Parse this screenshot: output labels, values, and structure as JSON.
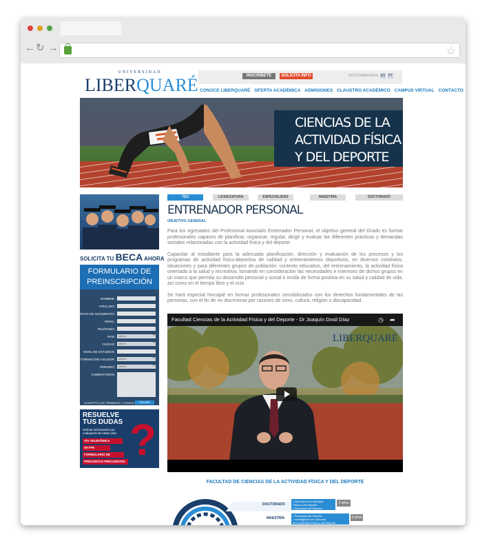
{
  "browser": {
    "colors": {
      "close": "#e0443e",
      "min": "#dea123",
      "max": "#53a548",
      "secure": "#58a23c"
    }
  },
  "site": {
    "logo_top": "UNIVERSIDAD",
    "logo_name_a": "LIBER",
    "logo_name_b": "QUARÉ",
    "top_buttons": {
      "inscribete": "INSCRÍBETE",
      "solicita": "SOLICITA INFO"
    },
    "utils": {
      "noticias": "NOTICIAS",
      "idiomas": "IDIOMAS",
      "es": "ES",
      "pt": "PT"
    },
    "menu": [
      "CONOCE LIBERQUARÉ",
      "OFERTA ACADÉMICA",
      "ADMISIONES",
      "CLAUSTRO ACADÉMICO",
      "CAMPUS VIRTUAL",
      "CONTACTO"
    ],
    "hero_title": [
      "CIENCIAS DE LA",
      "ACTIVIDAD FÍSICA",
      "Y DEL DEPORTE"
    ]
  },
  "sidebar": {
    "beca_pre": "SOLICITA TU",
    "beca": "BECA",
    "beca_post": "AHORA",
    "form_title": [
      "FORMULARIO DE",
      "PREINSCRIPCIÓN"
    ],
    "fields": [
      "NOMBRE:",
      "APELLIDO:",
      "FECHA DE NACIMIENTO:",
      "EMAIL:",
      "TELÉFONO:",
      "PAÍS:",
      "CIUDAD:",
      "NIVEL DE ESTUDIOS:",
      "FORMACIÓN A ELEGIR:",
      "PERIODO:",
      "COMENTARIOS:"
    ],
    "select_placeholder": "selecc.",
    "terms": "ACEPTO LOS TÉRMINOS Y CONDICIONES",
    "submit": "ENVIAR",
    "dudas_title": [
      "RESUELVE",
      "TUS DUDAS"
    ],
    "dudas_sub": [
      "Solicita información por",
      "cualquiera de estas vías:"
    ],
    "dudas_items": [
      "VÍA TELEFÓNICA",
      "SKYPE",
      "FORMULARIO DE",
      "PREGUNTAS FRECUENTES"
    ]
  },
  "main": {
    "tabs": [
      "TSU",
      "LICENCIATURA",
      "ESPECIALIDAD",
      "MAESTRÍA",
      "DOCTORADO"
    ],
    "title": "ENTRENADOR PERSONAL",
    "subtitle": "OBJETIVO GENERAL",
    "p1": "Para los egresados del Profesional Asociado Entrenador Personal, el objetivo general del Grado es formar profesionales capaces de planificar, organizar, regular, dirigir y evaluar las diferentes prácticas y demandas sociales relacionadas con la actividad física y del deporte.",
    "p2": "Capacitar al estudiante para la adecuada planificación, dirección y evaluación de los procesos y los programas de actividad físico-deportiva de calidad y entrenamientos deportivos, en diversos contextos, situaciones y para diferentes grupos de población: contexto educativo, del entrenamiento, la actividad física orientada a la salud y recreativa; tomando en consideración las necesidades e intereses de dichos grupos en un marco que permita su desarrollo personal y social e incida de forma positiva en su salud y calidad de vida, así como en el tiempo libre y el ocio.",
    "p3": "Se hará especial hincapié en formar profesionales sensibilizados con los derechos fundamentales de las personas, con el fin de no discriminar por razones de sexo, cultura, religión o discapacidad.",
    "video_title": "Facultad Ciencias de la Actividad Física y del Deporte - Dr Joaquín Dosil Díaz",
    "video_logo": "LIBERQUARÉ",
    "faculty": "FACULTAD DE CIENCIAS DE LA ACTIVIDAD FÍSICA Y DEL DEPORTE",
    "levels": [
      {
        "name": "DOCTORADO",
        "items": [
          "• Ciencias de la actividad",
          "Física y del Deporte",
          "• Psicología del Deporte"
        ],
        "years": "2 años"
      },
      {
        "name": "MAESTRÍA",
        "items": [
          "• Psicología del Deporte",
          "• Investigación en Ciencias",
          "de la actividad Física y del Deporte"
        ],
        "years": "3 años"
      }
    ]
  }
}
